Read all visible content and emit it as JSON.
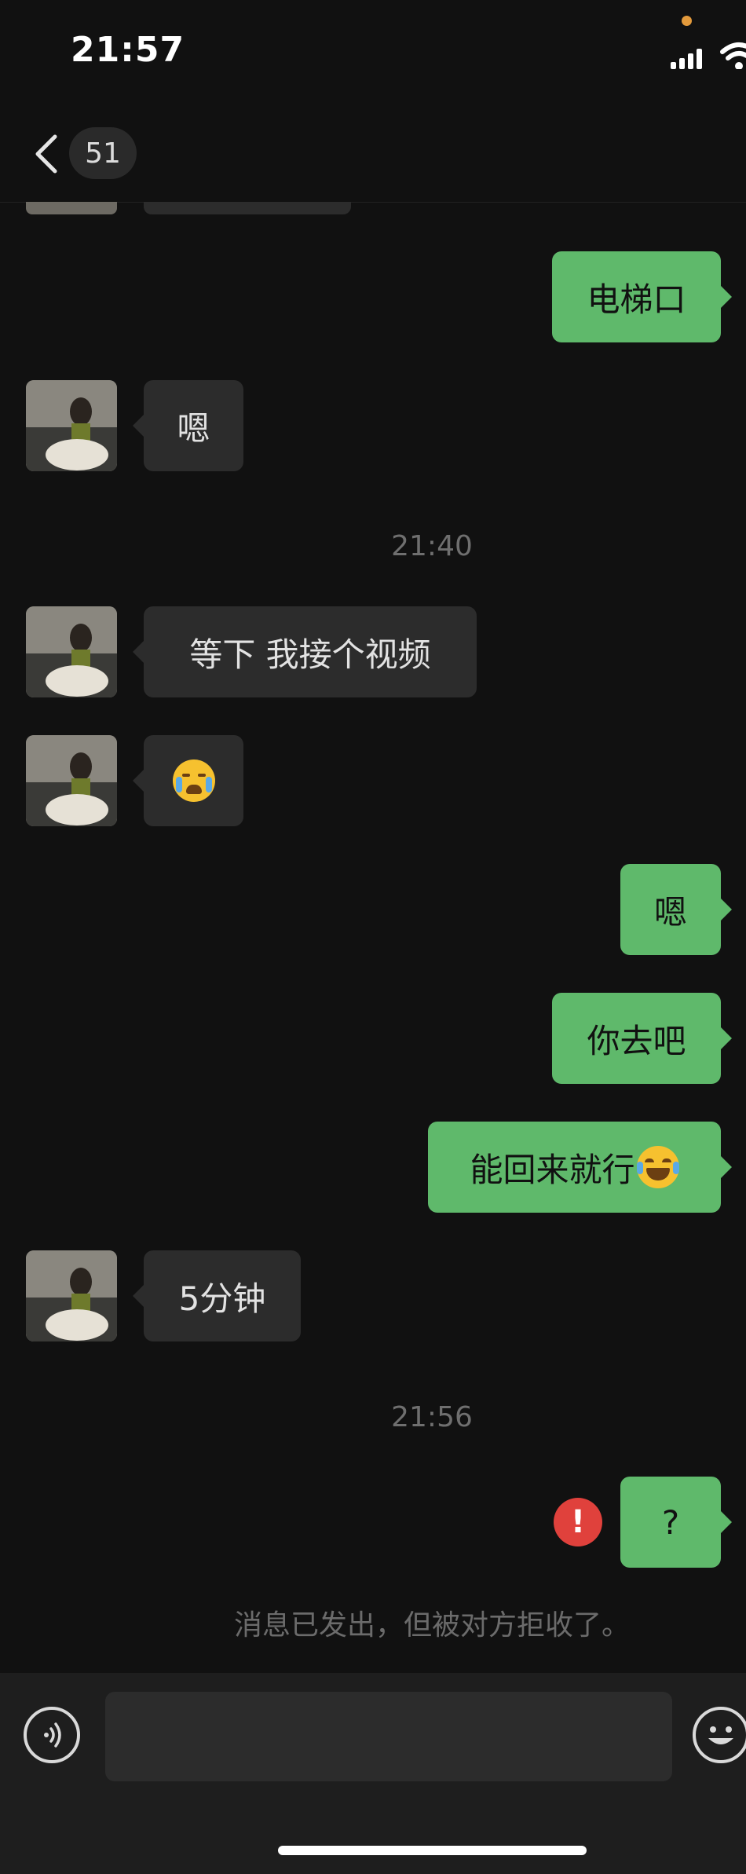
{
  "status_bar": {
    "time": "21:57"
  },
  "header": {
    "unread_count": "51"
  },
  "messages": [
    {
      "side": "out",
      "text": "电梯口"
    },
    {
      "side": "in",
      "text": "嗯"
    },
    {
      "timestamp": "21:40"
    },
    {
      "side": "in",
      "text": "等下 我接个视频"
    },
    {
      "side": "in",
      "emoji": "crying-face-emoji"
    },
    {
      "side": "out",
      "text": "嗯"
    },
    {
      "side": "out",
      "text": "你去吧"
    },
    {
      "side": "out",
      "text": "能回来就行",
      "emoji": "laughing-tears-emoji"
    },
    {
      "side": "in",
      "text": "5分钟"
    },
    {
      "timestamp": "21:56"
    },
    {
      "side": "out",
      "text": "?",
      "status": "failed"
    }
  ],
  "error": {
    "mark": "!"
  },
  "system_note": "消息已发出，但被对方拒收了。",
  "input_bar": {
    "placeholder": ""
  },
  "colors": {
    "outgoing_bubble": "#5fb96b",
    "incoming_bubble": "#2c2c2c",
    "background": "#111111",
    "error": "#e0413c"
  }
}
